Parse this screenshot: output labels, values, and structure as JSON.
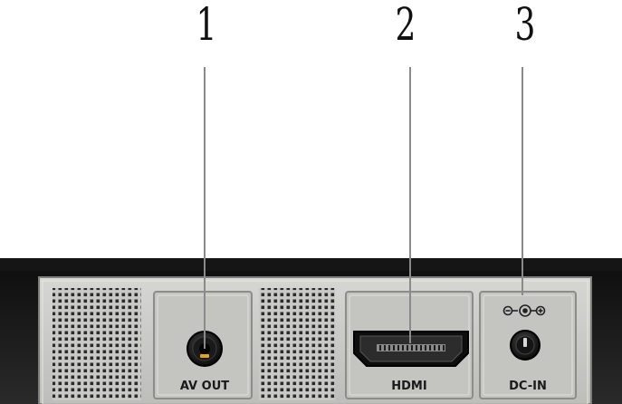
{
  "callouts": [
    {
      "number": "1",
      "port": "av-out"
    },
    {
      "number": "2",
      "port": "hdmi"
    },
    {
      "number": "3",
      "port": "dc-in"
    }
  ],
  "ports": {
    "av_out": {
      "label": "AV OUT"
    },
    "hdmi": {
      "label": "HDMI"
    },
    "dc_in": {
      "label": "DC-IN",
      "polarity_icon": "center-positive-polarity-icon"
    }
  },
  "colors": {
    "panel": "#c9c9c6",
    "housing": "#1c1c1c",
    "vent_hole": "#2b2b2b",
    "port_body": "#111111",
    "av_indicator": "#e2a320",
    "leader_line": "#8a8a8a"
  }
}
